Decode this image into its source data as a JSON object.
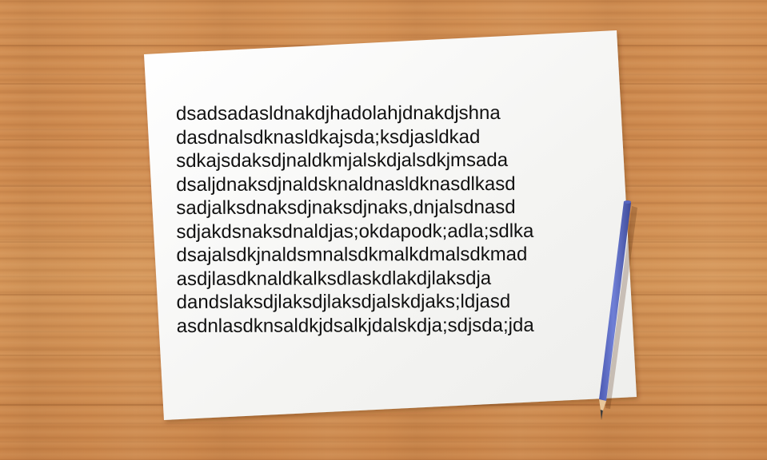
{
  "note": {
    "lines": [
      "dsadsadasldnakdjhadolahjdnakdjshna",
      "dasdnalsdknasldkajsda;ksdjasldkad",
      "sdkajsdaksdjnaldkmjalskdjalsdkjmsada",
      "dsaljdnaksdjnaldsknaldnasldknasdlkasd",
      "sadjalksdnaksdjnaksdjnaks,dnjalsdnasd",
      "sdjakdsnaksdnaldjas;okdapodk;adla;sdlka",
      "dsajalsdkjnaldsmnalsdkmalkdmalsdkmad",
      "asdjlasdknaldkalksdlaskdlakdjlaksdja",
      "dandslaksdjlaksdjlaksdjalskdjaks;ldjasd",
      "asdnlasdknsaldkjdsalkjdalskdja;sdjsda;jda"
    ]
  },
  "colors": {
    "desk": "#cf8a4e",
    "paper": "#f6f6f4",
    "ink": "#111111",
    "pencil_body": "#5f6fc8",
    "pencil_wood": "#e8c79a"
  }
}
